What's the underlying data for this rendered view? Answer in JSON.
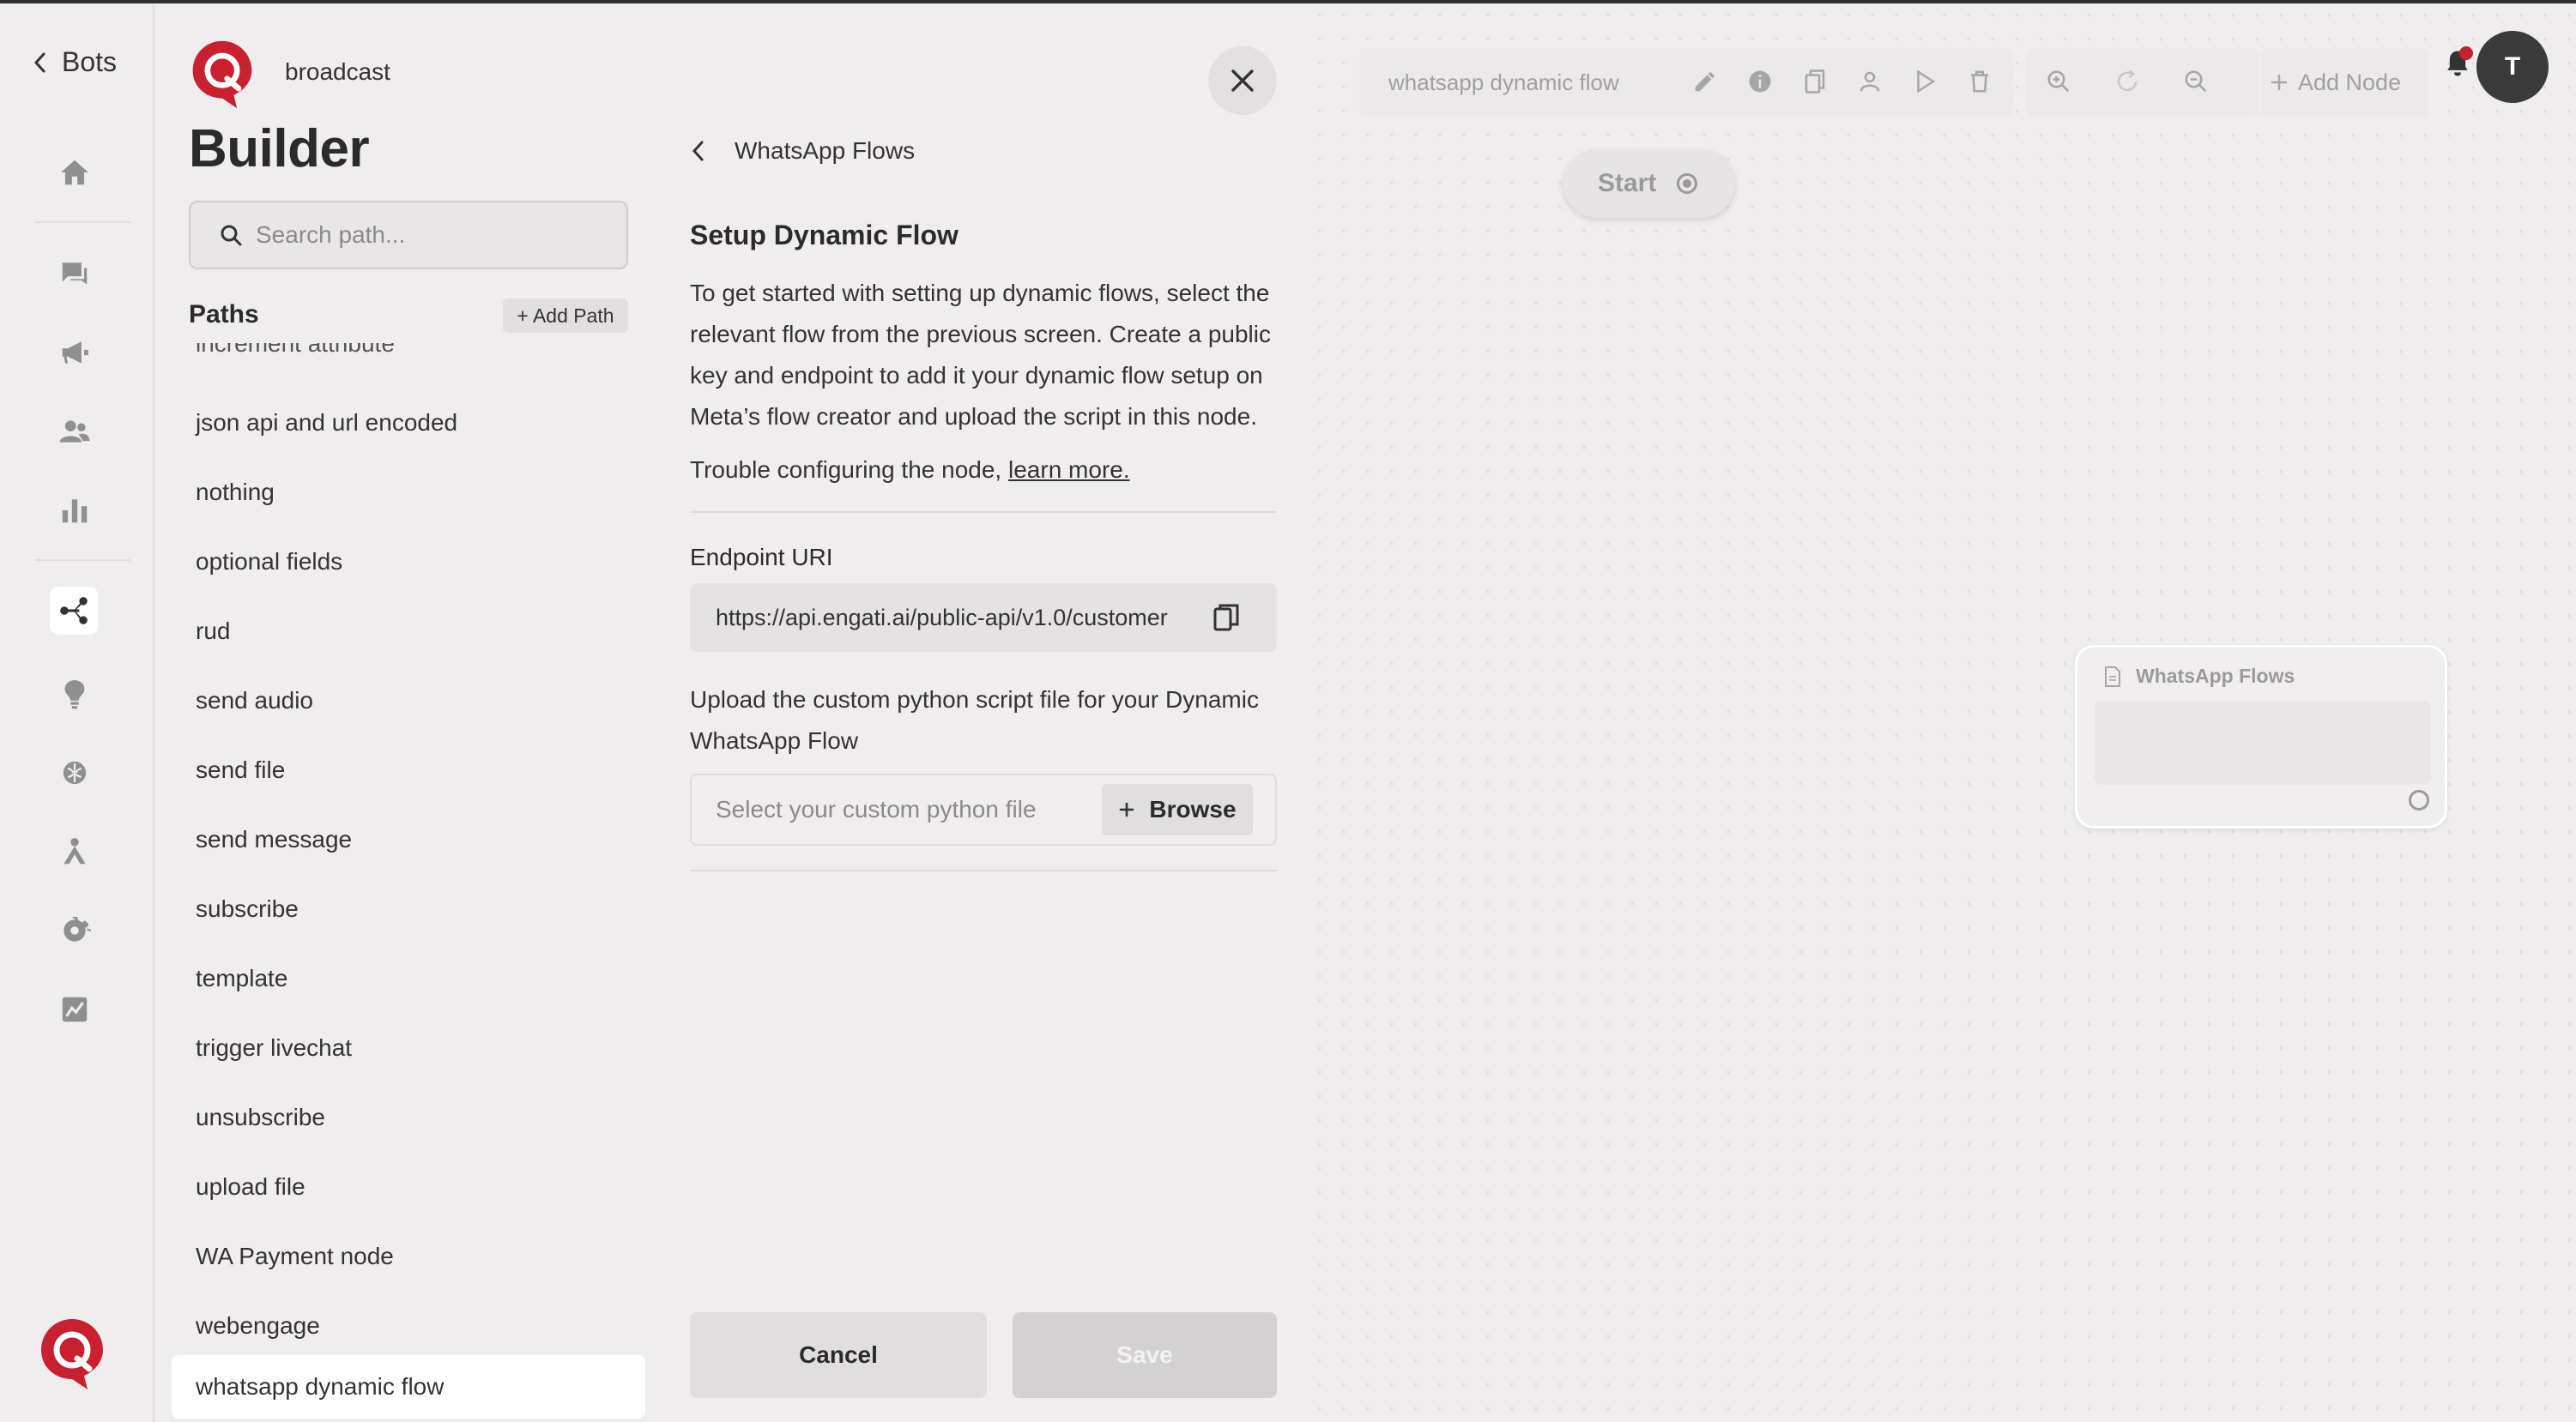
{
  "rail": {
    "back_label": "Bots"
  },
  "paths_panel": {
    "bot_name": "broadcast",
    "title": "Builder",
    "search_placeholder": "Search path...",
    "paths_label": "Paths",
    "add_path_label": "+ Add Path",
    "items": [
      "increment attribute",
      "json api and url encoded",
      "nothing",
      "optional fields",
      "rud",
      "send audio",
      "send file",
      "send message",
      "subscribe",
      "template",
      "trigger livechat",
      "unsubscribe",
      "upload file",
      "WA Payment node",
      "webengage",
      "whatsapp dynamic flow"
    ],
    "selected": "whatsapp dynamic flow"
  },
  "config": {
    "breadcrumb": "WhatsApp Flows",
    "title": "Setup Dynamic Flow",
    "description": "To get started with setting up dynamic flows, select the relevant flow from the previous screen. Create a public key and endpoint to add it your dynamic flow setup on Meta’s flow creator and upload the script in this node.",
    "trouble_prefix": "Trouble configuring the node,",
    "trouble_link": "learn more.",
    "endpoint_label": "Endpoint URI",
    "endpoint_value": "https://api.engati.ai/public-api/v1.0/customer",
    "upload_label": "Upload the custom python script file for your Dynamic WhatsApp Flow",
    "file_placeholder": "Select your custom python file",
    "browse_label": "Browse",
    "cancel_label": "Cancel",
    "save_label": "Save"
  },
  "canvas": {
    "flow_name": "whatsapp dynamic flow",
    "add_node_label": "Add Node",
    "avatar_initial": "T",
    "start_label": "Start",
    "node_title": "WhatsApp Flows"
  },
  "colors": {
    "brand": "#c8202f",
    "background": "#efedee",
    "notification_dot": "#c8202f"
  }
}
